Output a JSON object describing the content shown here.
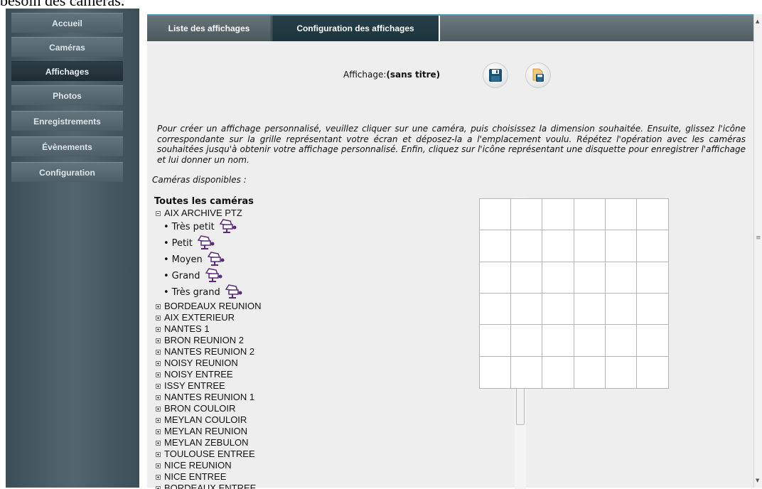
{
  "top_caption": "besoin des caméras.",
  "sidebar": {
    "items": [
      {
        "label": "Accueil",
        "active": false
      },
      {
        "label": "Caméras",
        "active": false
      },
      {
        "label": "Affichages",
        "active": true
      },
      {
        "label": "Photos",
        "active": false
      },
      {
        "label": "Enregistrements",
        "active": false
      },
      {
        "label": "Évènements",
        "active": false
      },
      {
        "label": "Configuration",
        "active": false
      }
    ]
  },
  "tabs": [
    {
      "label": "Liste des affichages",
      "active": false
    },
    {
      "label": "Configuration des affichages",
      "active": true
    }
  ],
  "display": {
    "label": "Affichage:",
    "name": "(sans titre)",
    "save_icon": "floppy-disk-icon",
    "save_as_icon": "save-as-icon"
  },
  "instructions": "Pour créer un affichage personnalisé, veuillez cliquer sur une caméra, puis choisissez la dimension souhaitée. Ensuite, glissez l'icône correspondante sur la grille représentant votre écran et déposez-la a l'emplacement voulu. Répétez l'opération avec les caméras souhaitées jusqu'à obtenir votre affichage personnalisé. Enfin, cliquez sur l'icône représentant une disquette pour enregistrer l'affichage et lui donner un nom.",
  "cameras_available_label": "Caméras disponibles :",
  "tree": {
    "title": "Toutes les caméras",
    "expanded_camera": "AIX ARCHIVE PTZ",
    "sizes": [
      "Très petit",
      "Petit",
      "Moyen",
      "Grand",
      "Très grand"
    ],
    "cameras": [
      "BORDEAUX REUNION",
      "AIX EXTERIEUR",
      "NANTES 1",
      "BRON REUNION 2",
      "NANTES REUNION 2",
      "NOISY REUNION",
      "NOISY ENTREE",
      "ISSY ENTREE",
      "NANTES REUNION 1",
      "BRON COULOIR",
      "MEYLAN COULOIR",
      "MEYLAN REUNION",
      "MEYLAN ZEBULON",
      "TOULOUSE ENTREE",
      "NICE REUNION",
      "NICE ENTREE",
      "BORDEAUX ENTREE"
    ]
  },
  "grid": {
    "rows": 6,
    "cols": 6
  },
  "colors": {
    "sidebar_bg": "#4a5d65",
    "active_item": "#22343b",
    "tab_active": "#1f3840",
    "content_bg": "#eeeeee",
    "accent_border": "#4a9ab5",
    "camera_icon": "#5b2a7e"
  }
}
